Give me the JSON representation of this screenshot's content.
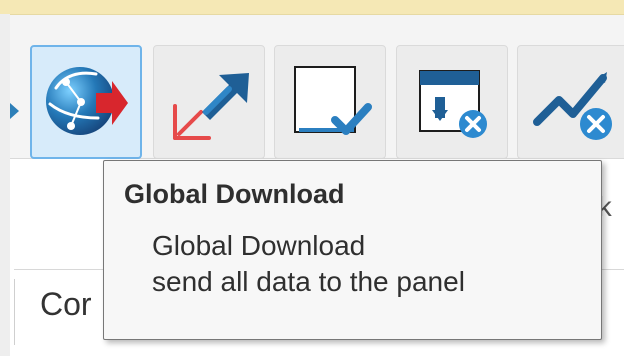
{
  "tooltip": {
    "title": "Global Download",
    "line1": "Global Download",
    "line2": "send all data to the panel"
  },
  "lower": {
    "left_label": "Cor",
    "right_hidden_fragment": "tk"
  },
  "toolbar": {
    "buttons": [
      {
        "icon": "global-download-icon"
      },
      {
        "icon": "upload-arrow-icon"
      },
      {
        "icon": "checkbox-selection-icon"
      },
      {
        "icon": "download-cancel-icon"
      },
      {
        "icon": "trend-cancel-icon"
      }
    ]
  },
  "colors": {
    "active_border": "#6fb4ea",
    "active_fill": "#d7ebfa",
    "accent_blue": "#2d7fb8",
    "accent_red": "#d8262d"
  }
}
